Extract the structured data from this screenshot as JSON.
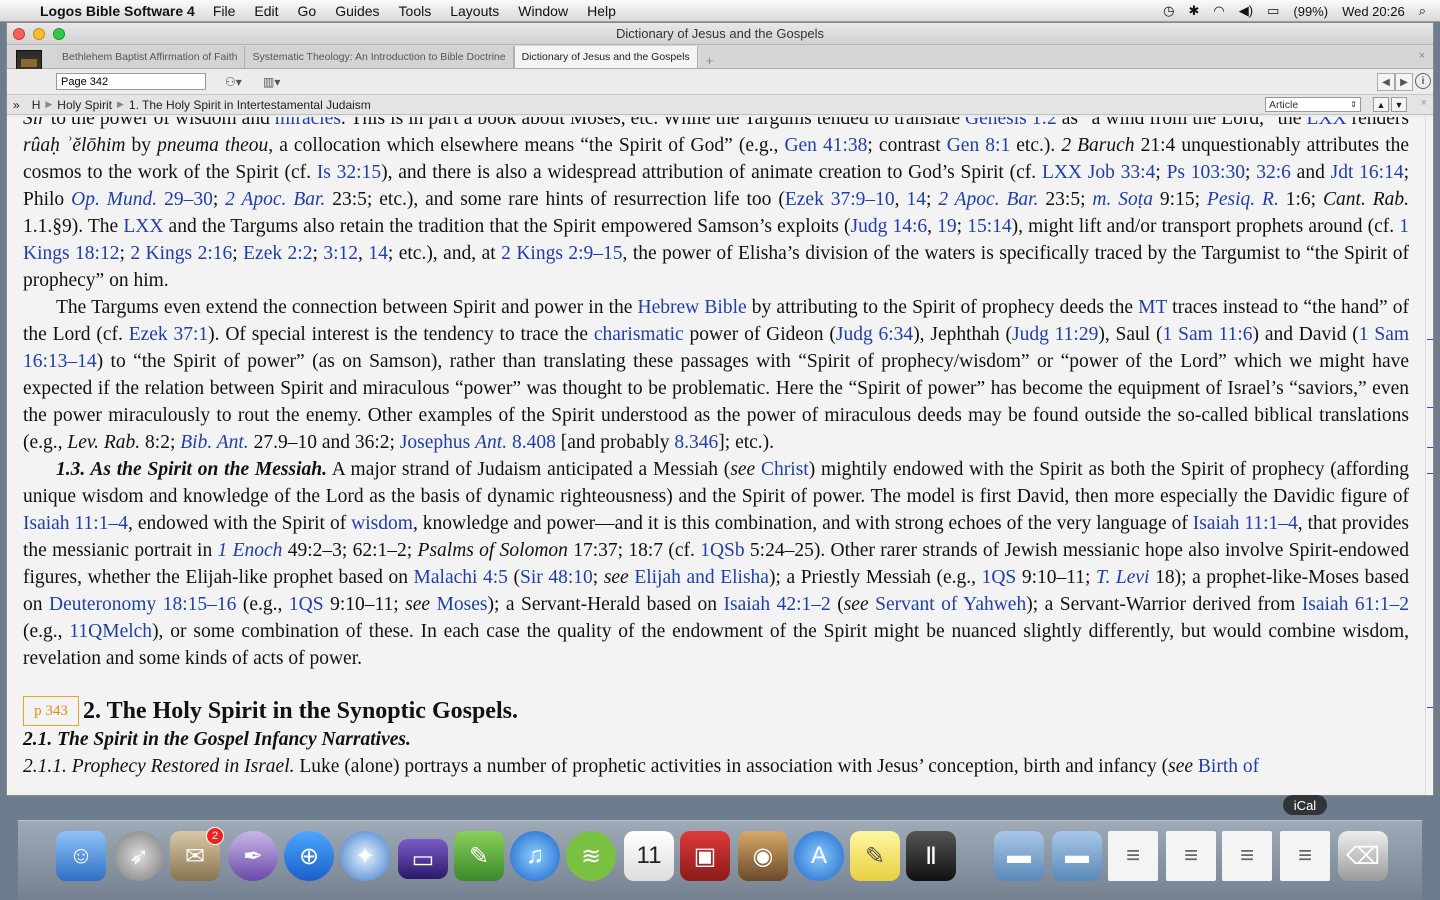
{
  "menubar": {
    "app_name": "Logos Bible Software 4",
    "items": [
      "File",
      "Edit",
      "Go",
      "Guides",
      "Tools",
      "Layouts",
      "Window",
      "Help"
    ],
    "battery": "(99%)",
    "clock": "Wed 20:26"
  },
  "window": {
    "title": "Dictionary of Jesus and the Gospels",
    "tabs": [
      {
        "label": "Bethlehem Baptist Affirmation of Faith"
      },
      {
        "label": "Systematic Theology: An Introduction to Bible Doctrine"
      },
      {
        "label": "Dictionary of Jesus and the Gospels"
      }
    ],
    "tab_add": "+",
    "tab_close": "×",
    "page_input": "Page 342",
    "breadcrumb": {
      "toggle": "»",
      "root": "H",
      "items": [
        "Holy Spirit",
        "1. The Holy Spirit in Intertestamental Judaism"
      ]
    },
    "view_select": "Article"
  },
  "article": {
    "page_marker": "p 343",
    "section_title": "2. The Holy Spirit in the Synoptic Gospels.",
    "subheading": "2.1. The Spirit in the Gospel Infancy Narratives.",
    "subsubheading_label": "2.1.1. Prophecy Restored in Israel.",
    "subsubheading_text": " Luke (alone) portrays a number of prophetic activities in association with Jesus’ conception, birth and infancy (",
    "subsubheading_see": "see",
    "subsubheading_ref": "Birth of"
  },
  "dock": {
    "tooltip": "iCal",
    "badge_count": "2",
    "icons": [
      "finder-icon",
      "launchpad-icon",
      "mail-icon",
      "quill-icon",
      "logos-search-icon",
      "safari-icon",
      "screen-icon",
      "evernote-icon",
      "itunes-icon",
      "spotify-icon",
      "ical-icon",
      "photo-booth-icon",
      "preview-icon",
      "appstore-icon",
      "stickies-icon",
      "final-cut-icon",
      "folder-icon",
      "folder-icon-2",
      "window-thumb-1",
      "window-thumb-2",
      "window-thumb-3",
      "window-thumb-4",
      "trash-icon"
    ]
  }
}
